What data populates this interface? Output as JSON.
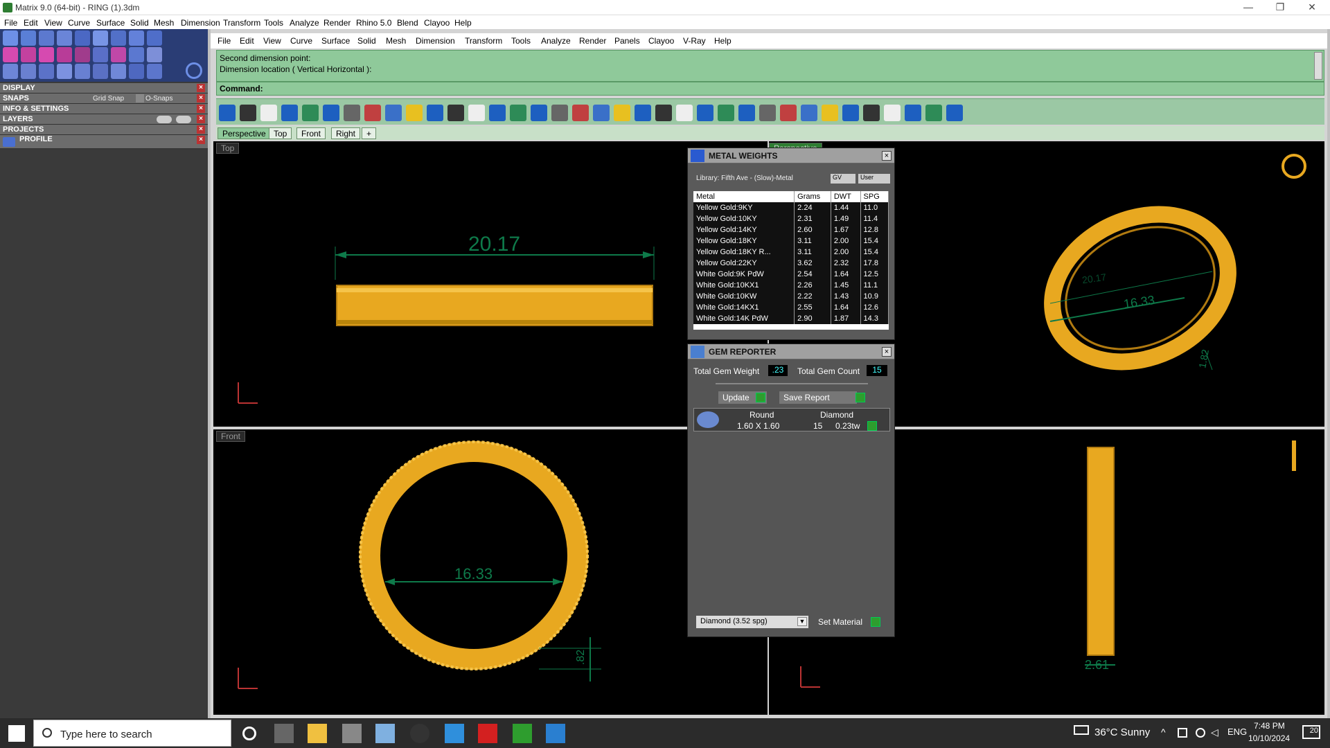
{
  "window": {
    "title": "Matrix 9.0 (64-bit) - RING (1).3dm",
    "minimize": "—",
    "restore": "❐",
    "close": "✕"
  },
  "menubar_top": [
    "File",
    "Edit",
    "View",
    "Curve",
    "Surface",
    "Solid",
    "Mesh",
    "Dimension",
    "Transform",
    "Tools",
    "Analyze",
    "Render",
    "Rhino 5.0",
    "Blend",
    "Clayoo",
    "Help"
  ],
  "menubar_main": [
    "File",
    "Edit",
    "View",
    "Curve",
    "Surface",
    "Solid",
    "Mesh",
    "Dimension",
    "Transform",
    "Tools",
    "Analyze",
    "Render",
    "Panels",
    "Clayoo",
    "V-Ray",
    "Help"
  ],
  "left_panel": {
    "rows": [
      {
        "label": "DISPLAY"
      },
      {
        "label": "SNAPS",
        "grid_snap": "Grid Snap",
        "osnaps": "O-Snaps"
      },
      {
        "label": "INFO & SETTINGS"
      },
      {
        "label": "LAYERS"
      },
      {
        "label": "PROJECTS"
      },
      {
        "label": "PROFILE"
      }
    ]
  },
  "command": {
    "history_line1": "Second dimension point:",
    "history_line2": "Dimension location ( Vertical  Horizontal ):",
    "prompt": "Command:"
  },
  "view_tabs": [
    "Perspective",
    "Top",
    "Front",
    "Right"
  ],
  "viewports": {
    "top_label": "Top",
    "front_label": "Front",
    "perspective_label": "Perspective",
    "top_dim": "20.17",
    "front_dim": "16.33",
    "front_dim_small": ".82",
    "persp_dim": "16.33",
    "persp_dim_faint": "20.17",
    "persp_dim_small": "1.82",
    "right_dim": "2.61"
  },
  "metal_weights": {
    "title": "METAL WEIGHTS",
    "library": "Library: Fifth Ave - (Slow)-Metal",
    "gv": "GV",
    "user": "User",
    "columns": [
      "Metal",
      "Grams",
      "DWT",
      "SPG"
    ],
    "rows": [
      [
        "Yellow Gold:9KY",
        "2.24",
        "1.44",
        "11.0"
      ],
      [
        "Yellow Gold:10KY",
        "2.31",
        "1.49",
        "11.4"
      ],
      [
        "Yellow Gold:14KY",
        "2.60",
        "1.67",
        "12.8"
      ],
      [
        "Yellow Gold:18KY",
        "3.11",
        "2.00",
        "15.4"
      ],
      [
        "Yellow Gold:18KY R...",
        "3.11",
        "2.00",
        "15.4"
      ],
      [
        "Yellow Gold:22KY",
        "3.62",
        "2.32",
        "17.8"
      ],
      [
        "White Gold:9K PdW",
        "2.54",
        "1.64",
        "12.5"
      ],
      [
        "White Gold:10KX1",
        "2.26",
        "1.45",
        "11.1"
      ],
      [
        "White Gold:10KW",
        "2.22",
        "1.43",
        "10.9"
      ],
      [
        "White Gold:14KX1",
        "2.55",
        "1.64",
        "12.6"
      ],
      [
        "White Gold:14K PdW",
        "2.90",
        "1.87",
        "14.3"
      ]
    ]
  },
  "gem_reporter": {
    "title": "GEM REPORTER",
    "total_weight_label": "Total Gem Weight",
    "total_weight": ".23",
    "total_count_label": "Total Gem Count",
    "total_count": "15",
    "update": "Update",
    "save_report": "Save Report",
    "col_shape": "Round",
    "col_type": "Diamond",
    "size": "1.60 X 1.60",
    "count": "15",
    "tw": "0.23tw",
    "material": "Diamond    (3.52 spg)",
    "set_material": "Set Material"
  },
  "taskbar": {
    "search_placeholder": "Type here to search",
    "weather": "36°C  Sunny",
    "lang": "ENG",
    "time": "7:48 PM",
    "date": "10/10/2024",
    "notif": "20"
  },
  "colors": {
    "gold": "#e8a820",
    "dim_green": "#0e7a4a",
    "cmd_green": "#8fc99a"
  }
}
